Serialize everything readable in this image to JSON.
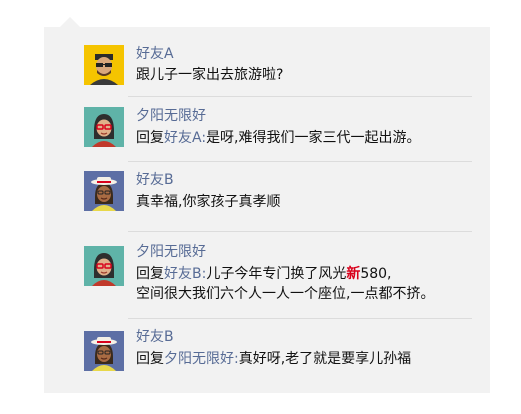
{
  "comments": [
    {
      "author": "好友A",
      "avatar_icon": "man-sunglasses-avatar-icon",
      "text": "跟儿子一家出去旅游啦?"
    },
    {
      "author": "夕阳无限好",
      "avatar_icon": "woman-red-glasses-avatar-icon",
      "reply_prefix": "回复",
      "reply_to": "好友A:",
      "text": "是呀,难得我们一家三代一起出游。"
    },
    {
      "author": "好友B",
      "avatar_icon": "woman-hat-avatar-icon",
      "text": "真幸福,你家孩子真孝顺"
    },
    {
      "author": "夕阳无限好",
      "avatar_icon": "woman-red-glasses-avatar-icon",
      "reply_prefix": "回复",
      "reply_to": "好友B:",
      "text_part1": "儿子今年专门换了风光",
      "text_highlight": "新",
      "text_part2": "580,",
      "text_line2": "空间很大我们六个人一人一个座位,一点都不挤。"
    },
    {
      "author": "好友B",
      "avatar_icon": "woman-hat-avatar-icon",
      "reply_prefix": "回复",
      "reply_to": "夕阳无限好:",
      "text": "真好呀,老了就是要享儿孙福"
    }
  ],
  "colors": {
    "panel_bg": "#f2f2f2",
    "name_link": "#576b95",
    "text": "#111111",
    "highlight": "#d9001b",
    "divider": "#dcdcdc"
  }
}
